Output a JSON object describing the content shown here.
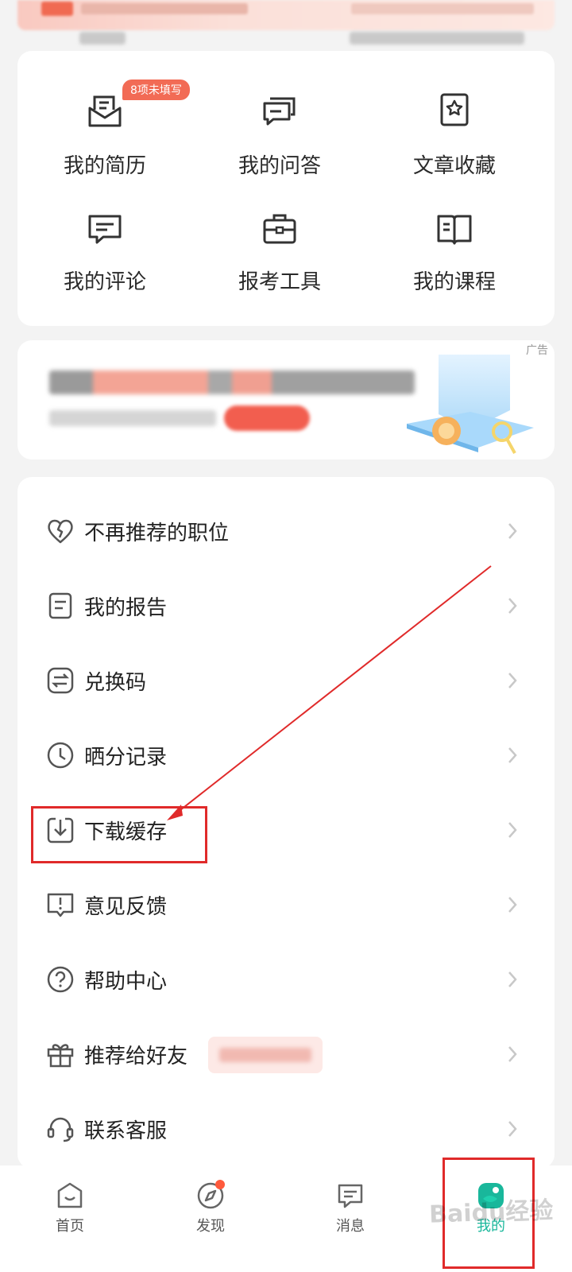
{
  "grid": {
    "badge": "8项未填写",
    "items": [
      {
        "label": "我的简历",
        "icon": "resume-icon"
      },
      {
        "label": "我的问答",
        "icon": "qa-icon"
      },
      {
        "label": "文章收藏",
        "icon": "bookmark-icon"
      },
      {
        "label": "我的评论",
        "icon": "comment-icon"
      },
      {
        "label": "报考工具",
        "icon": "toolbox-icon"
      },
      {
        "label": "我的课程",
        "icon": "book-icon"
      }
    ]
  },
  "ad": {
    "label": "广告"
  },
  "menu": {
    "items": [
      {
        "label": "不再推荐的职位",
        "icon": "broken-heart-icon"
      },
      {
        "label": "我的报告",
        "icon": "report-icon"
      },
      {
        "label": "兑换码",
        "icon": "exchange-icon"
      },
      {
        "label": "晒分记录",
        "icon": "clock-icon"
      },
      {
        "label": "下载缓存",
        "icon": "download-icon"
      },
      {
        "label": "意见反馈",
        "icon": "feedback-icon"
      },
      {
        "label": "帮助中心",
        "icon": "help-icon"
      },
      {
        "label": "推荐给好友",
        "icon": "gift-icon"
      },
      {
        "label": "联系客服",
        "icon": "headset-icon"
      }
    ]
  },
  "tabs": [
    {
      "label": "首页",
      "icon": "home-icon"
    },
    {
      "label": "发现",
      "icon": "compass-icon"
    },
    {
      "label": "消息",
      "icon": "message-icon"
    },
    {
      "label": "我的",
      "icon": "profile-icon"
    }
  ],
  "colors": {
    "accent": "#19b79b",
    "badge": "#f26b55",
    "annotation": "#e02a2a"
  },
  "watermark": "Baidu经验"
}
